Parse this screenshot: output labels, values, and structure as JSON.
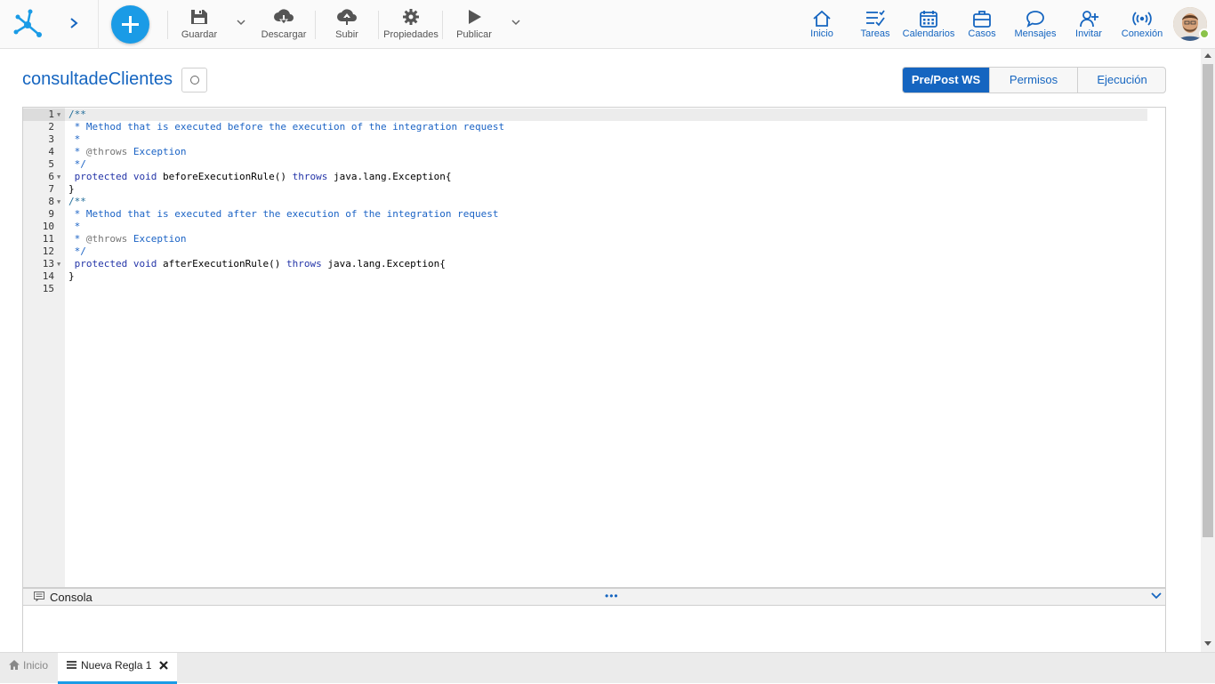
{
  "toolbar": {
    "save_label": "Guardar",
    "download_label": "Descargar",
    "upload_label": "Subir",
    "properties_label": "Propiedades",
    "publish_label": "Publicar"
  },
  "nav": {
    "home": "Inicio",
    "tasks": "Tareas",
    "calendars": "Calendarios",
    "cases": "Casos",
    "messages": "Mensajes",
    "invite": "Invitar",
    "connection": "Conexión"
  },
  "page": {
    "title": "consultadeClientes"
  },
  "tabs": [
    {
      "label": "Pre/Post WS",
      "active": true
    },
    {
      "label": "Permisos",
      "active": false
    },
    {
      "label": "Ejecución",
      "active": false
    }
  ],
  "editor": {
    "line_numbers": [
      "1",
      "2",
      "3",
      "4",
      "5",
      "6",
      "7",
      "8",
      "9",
      "10",
      "11",
      "12",
      "13",
      "14",
      "15"
    ],
    "lines": {
      "l1": "/**",
      "l2": " * Method that is executed before the execution of the integration request",
      "l3": " *",
      "l4_star": " * ",
      "l4_tag": "@throws",
      "l4_rest": " Exception",
      "l5": " */",
      "l6_kw": " protected void",
      "l6_mid": " beforeExecutionRule() ",
      "l6_kw2": "throws",
      "l6_rest": " java.lang.Exception{",
      "l7": "}",
      "l8": "/**",
      "l9": " * Method that is executed after the execution of the integration request",
      "l10": " *",
      "l11_star": " * ",
      "l11_tag": "@throws",
      "l11_rest": " Exception",
      "l12": " */",
      "l13_kw": " protected void",
      "l13_mid": " afterExecutionRule() ",
      "l13_kw2": "throws",
      "l13_rest": " java.lang.Exception{",
      "l14": "}",
      "l15": ""
    }
  },
  "console": {
    "label": "Consola",
    "handle": "•••"
  },
  "taskbar": {
    "home": "Inicio",
    "rule_tab": "Nueva Regla 1"
  },
  "colors": {
    "accent": "#1565c0",
    "brand": "#1a9be6",
    "status_online": "#8bc34a"
  }
}
